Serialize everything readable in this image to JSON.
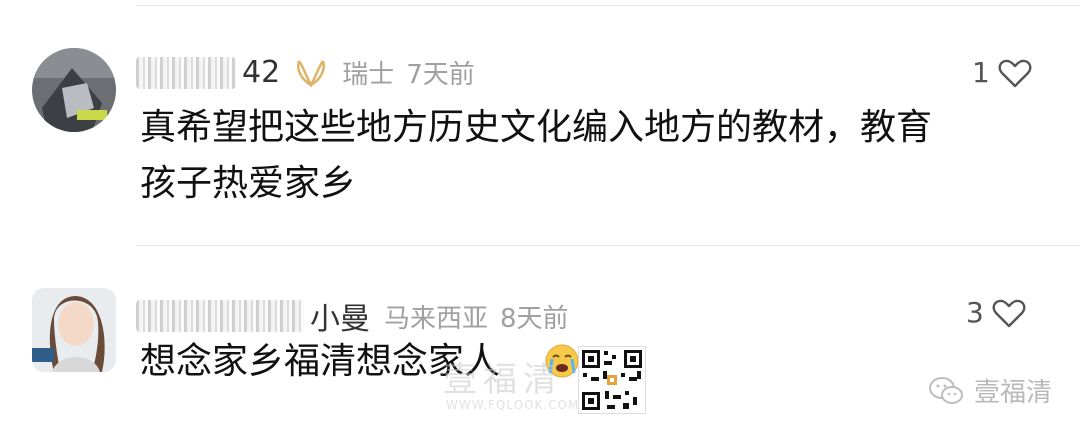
{
  "comments": [
    {
      "username_tail": "42",
      "location": "瑞士",
      "time": "7天前",
      "likes": "1",
      "text_line1": "真希望把这些地方历史文化编入地方的教材，教育",
      "text_line2": "孩子热爱家乡"
    },
    {
      "username_tail": "小曼",
      "location": "马来西亚",
      "time": "8天前",
      "likes": "3",
      "text": "想念家乡福清想念家人"
    }
  ],
  "watermark": {
    "name": "壹福清",
    "site_cn": "壹福清",
    "site_url": "WWW.FQLOOK.COM"
  },
  "icons": {
    "like": "heart-outline-icon",
    "badge": "gold-ribbon-icon",
    "emoji": "crying-face-icon",
    "brand": "wechat-icon"
  },
  "colors": {
    "meta": "#a0a0a0",
    "badge": "#e0b36a",
    "divider": "#e6e6e6"
  }
}
